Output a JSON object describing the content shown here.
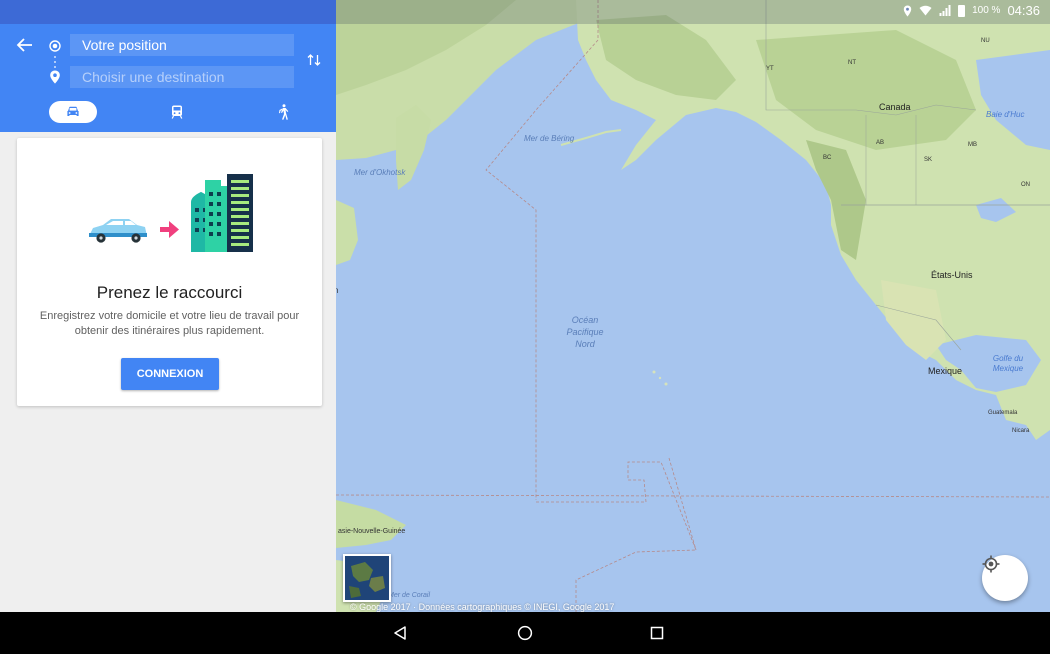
{
  "status_bar": {
    "battery": "100 %",
    "time": "04:36"
  },
  "directions": {
    "origin_value": "Votre position",
    "destination_placeholder": "Choisir une destination",
    "modes": [
      "car",
      "transit",
      "walk"
    ],
    "selected_mode": "car"
  },
  "card": {
    "title": "Prenez le raccourci",
    "text": "Enregistrez votre domicile et votre lieu de travail pour obtenir des itinéraires plus rapidement.",
    "button_label": "CONNEXION"
  },
  "map": {
    "labels": {
      "bering": "Mer de Béring",
      "okhotsk": "Mer d'Okhotsk",
      "ocean_line1": "Océan",
      "ocean_line2": "Pacifique",
      "ocean_line3": "Nord",
      "canada": "Canada",
      "usa": "États-Unis",
      "mexico": "Mexique",
      "gulf_line1": "Golfe du",
      "gulf_line2": "Mexique",
      "hudson": "Baie d'Huc",
      "png": "asie-Nouvelle-Guinée",
      "coral": "Mer de Corail",
      "guatemala": "Guatemala",
      "nicaragua": "Nicara",
      "nu": "NU",
      "nt": "NT",
      "yt": "YT",
      "ab": "AB",
      "bc": "BC",
      "sk": "SK",
      "mb": "MB",
      "on": "ON",
      "n_letter": "n"
    },
    "copyright": "© Google 2017 · Données cartographiques © INEGI, Google 2017"
  },
  "colors": {
    "header_blue": "#4285f4",
    "ocean": "#a7c5ee",
    "land": "#cfe2b0",
    "connect_button": "#4285f4"
  }
}
